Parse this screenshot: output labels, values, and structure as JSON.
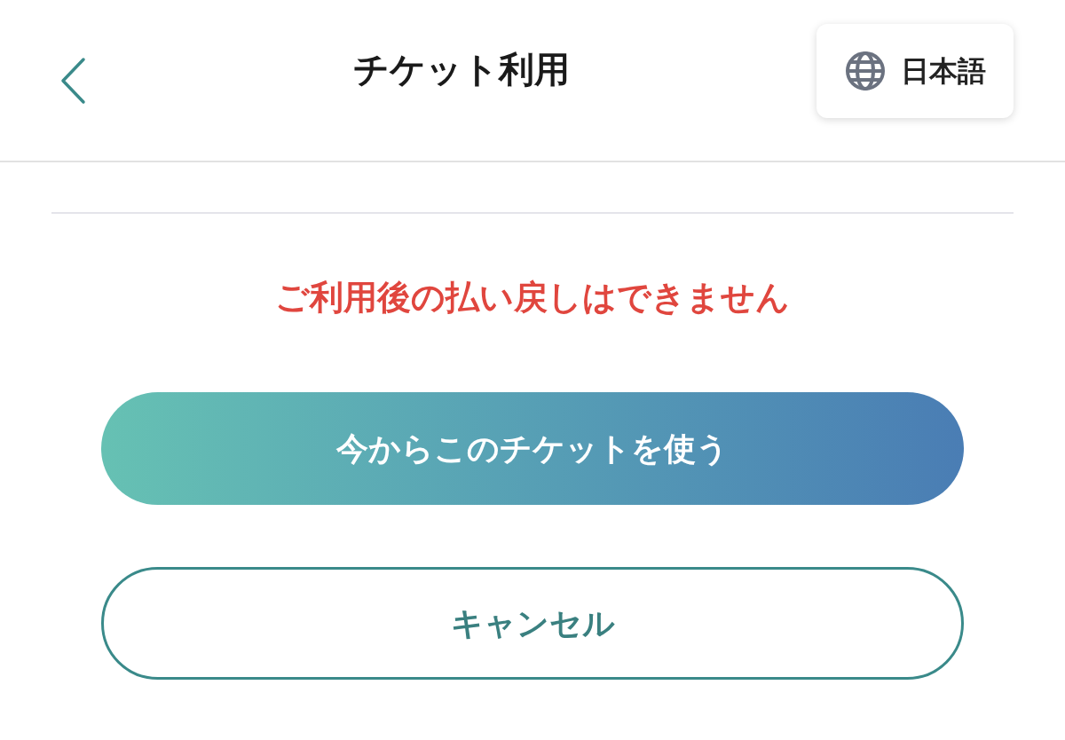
{
  "header": {
    "title": "チケット利用",
    "language_button": {
      "label": "日本語"
    }
  },
  "notice": "ご利用後の払い戻しはできません",
  "buttons": [
    {
      "label": "今からこのチケットを使う",
      "kind": "primary"
    },
    {
      "label": "キャンセル",
      "kind": "outline"
    }
  ]
}
